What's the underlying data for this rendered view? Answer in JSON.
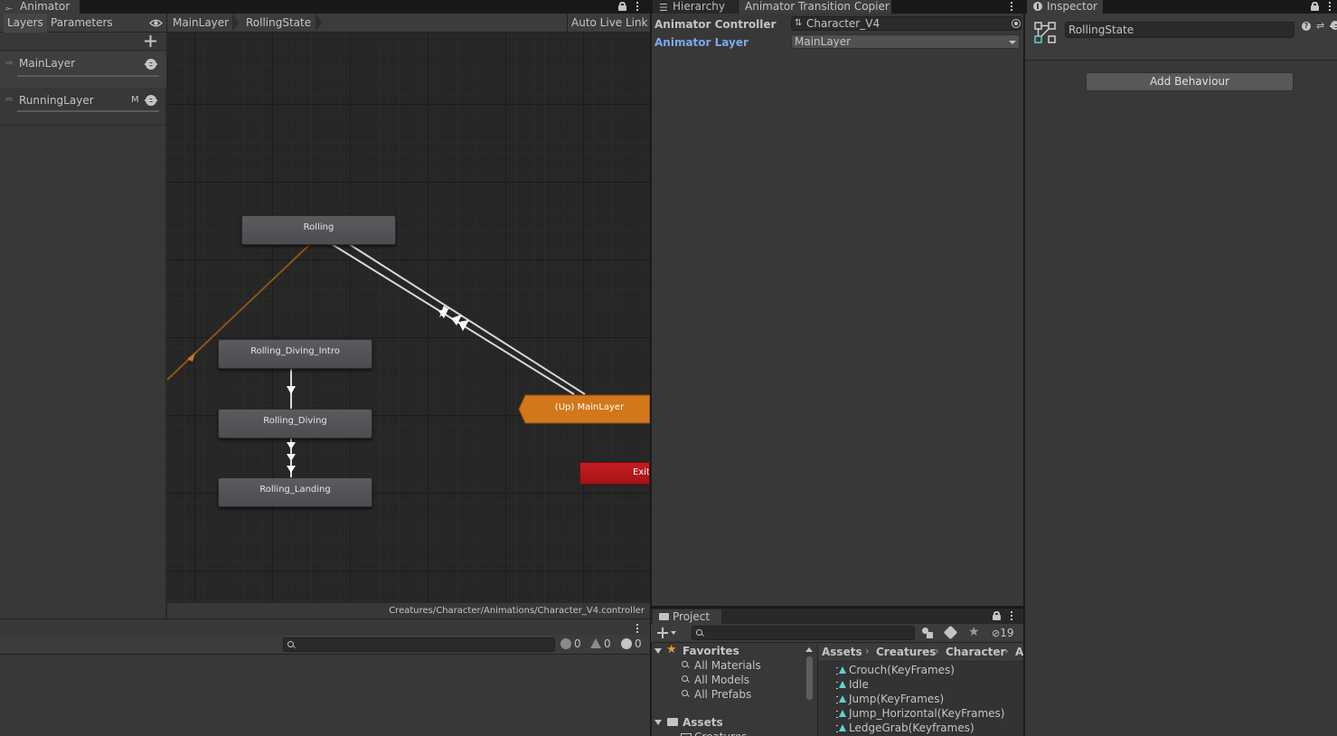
{
  "animator": {
    "tab_title": "Animator",
    "tabs": {
      "layers": "Layers",
      "parameters": "Parameters"
    },
    "breadcrumb": [
      "MainLayer",
      "RollingState"
    ],
    "auto_live_link": "Auto Live Link",
    "layers": [
      {
        "name": "MainLayer",
        "badge": ""
      },
      {
        "name": "RunningLayer",
        "badge": "M"
      }
    ],
    "states": {
      "rolling": "Rolling",
      "diving_intro": "Rolling_Diving_Intro",
      "diving": "Rolling_Diving",
      "landing": "Rolling_Landing",
      "up_main": "(Up) MainLayer",
      "exit": "Exit"
    },
    "colors": {
      "state": "#505155",
      "up_state": "#d2771a",
      "exit": "#c0191d",
      "entry_transition": "#8a5512"
    },
    "path": "Creatures/Character/Animations/Character_V4.controller"
  },
  "console": {
    "counts": {
      "log": "0",
      "warning": "0",
      "error": "0"
    }
  },
  "middle": {
    "tabs": {
      "hierarchy": "Hierarchy",
      "copier": "Animator Transition Copier"
    },
    "controller_label": "Animator Controller",
    "controller_value": "Character_V4",
    "layer_label": "Animator Layer",
    "layer_value": "MainLayer",
    "accent": "#7ba9ea"
  },
  "project": {
    "tab_title": "Project",
    "hidden_count": "19",
    "favorites": {
      "title": "Favorites",
      "items": [
        "All Materials",
        "All Models",
        "All Prefabs"
      ]
    },
    "assets_title": "Assets",
    "assets_child": "Creatures",
    "breadcrumb": [
      "Assets",
      "Creatures",
      "Character",
      "A"
    ],
    "files": [
      "Crouch(KeyFrames)",
      "Idle",
      "Jump(KeyFrames)",
      "Jump_Horizontal(KeyFrames)",
      "LedgeGrab(Keyframes)"
    ]
  },
  "inspector": {
    "tab_title": "Inspector",
    "name_value": "RollingState",
    "add_behaviour": "Add Behaviour"
  }
}
